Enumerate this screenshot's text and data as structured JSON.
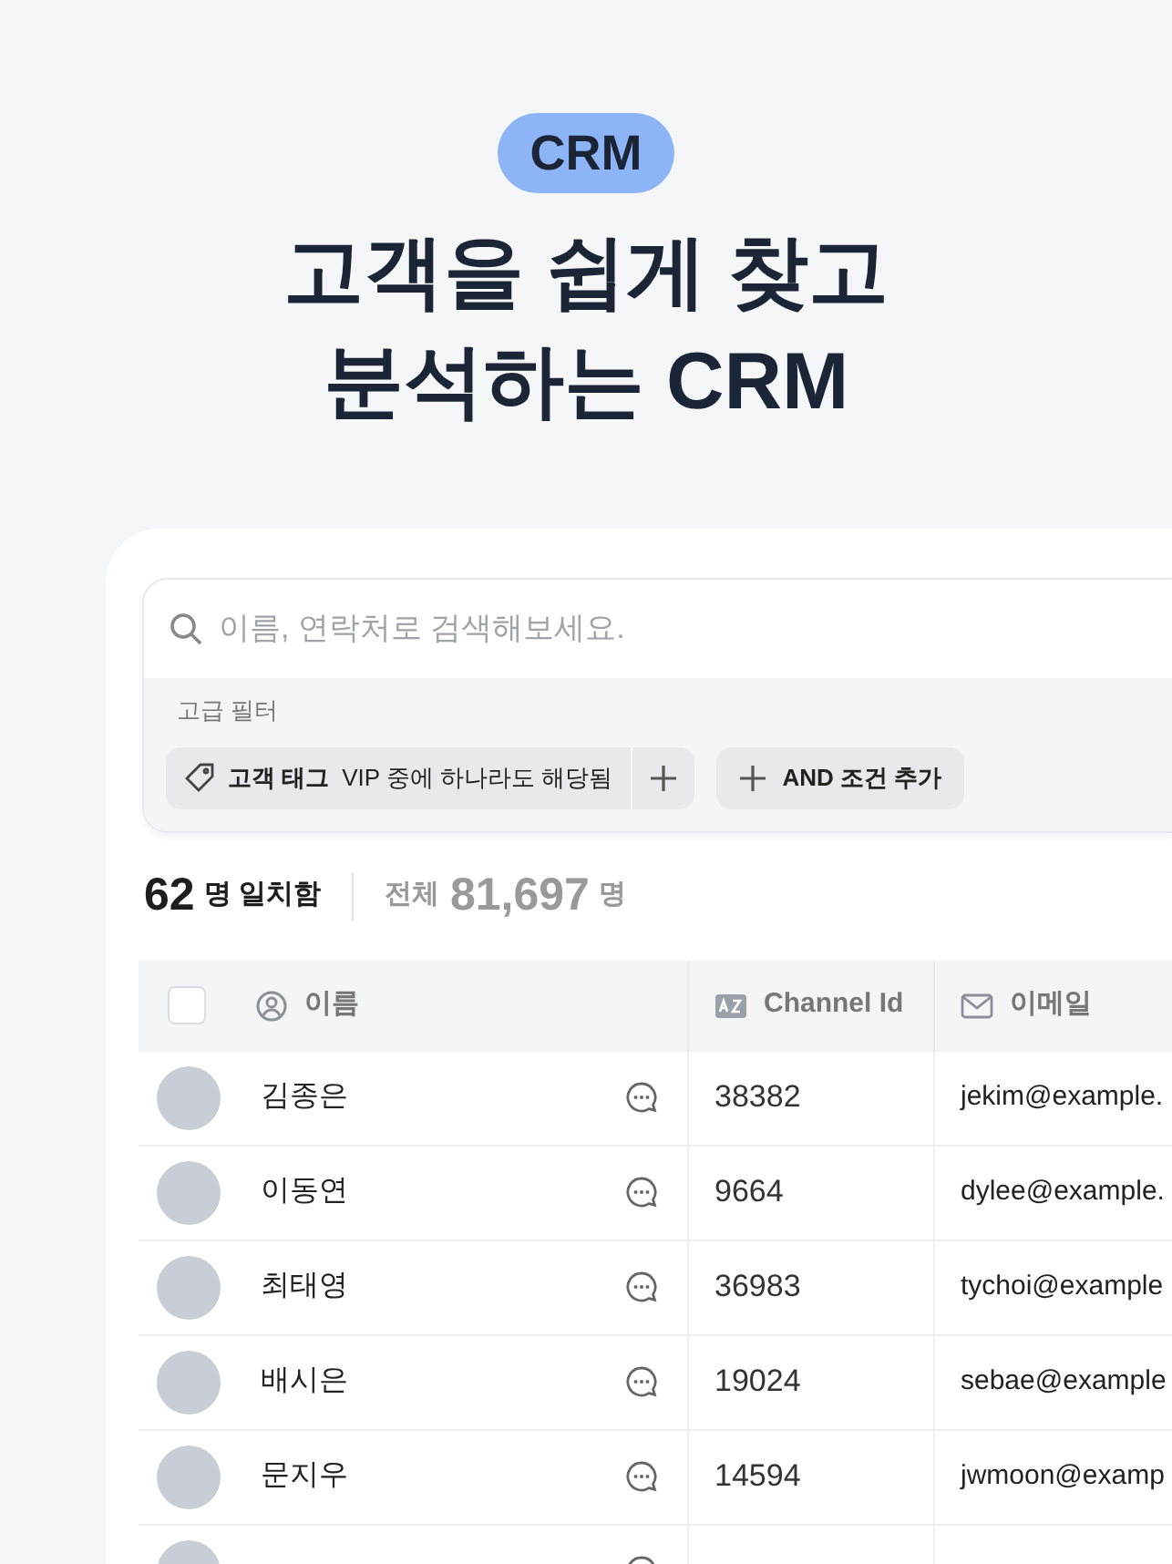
{
  "badge": "CRM",
  "headline": [
    "고객을 쉽게 찾고",
    "분석하는 CRM"
  ],
  "search": {
    "placeholder": "이름, 연락처로 검색해보세요."
  },
  "filter": {
    "label": "고급 필터",
    "condition": {
      "field": "고객 태그",
      "rest": "VIP 중에 하나라도 해당됨"
    },
    "add_button": "AND 조건 추가"
  },
  "counts": {
    "matched": "62",
    "matched_unit": "명 일치함",
    "total_label": "전체",
    "total": "81,697",
    "total_unit": "명"
  },
  "table": {
    "select_all": {
      "checked": false
    },
    "columns": [
      {
        "kind": "person",
        "label": "이름"
      },
      {
        "kind": "text",
        "label": "Channel Id"
      },
      {
        "kind": "mail",
        "label": "이메일"
      }
    ],
    "rows": [
      {
        "photo": true,
        "name": "김종은",
        "channel_id": "38382",
        "email": "jekim@example."
      },
      {
        "photo": true,
        "name": "이동연",
        "channel_id": "9664",
        "email": "dylee@example."
      },
      {
        "photo": true,
        "name": "최태영",
        "channel_id": "36983",
        "email": "tychoi@example"
      },
      {
        "photo": true,
        "name": "배시은",
        "channel_id": "19024",
        "email": "sebae@example"
      },
      {
        "photo": true,
        "name": "문지우",
        "channel_id": "14594",
        "email": "jwmoon@examp"
      },
      {
        "photo": true
      }
    ]
  }
}
